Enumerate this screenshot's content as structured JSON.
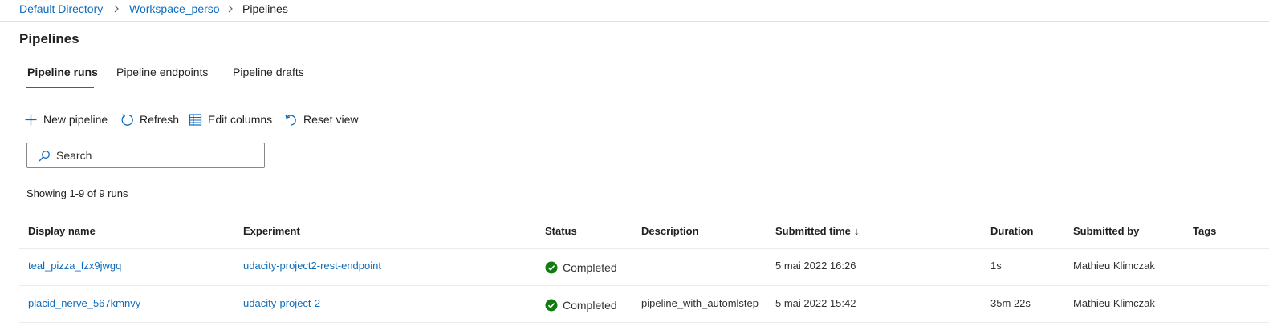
{
  "breadcrumb": {
    "items": [
      "Default Directory",
      "Workspace_perso",
      "Pipelines"
    ]
  },
  "page": {
    "title": "Pipelines"
  },
  "tabs": [
    {
      "label": "Pipeline runs",
      "active": true
    },
    {
      "label": "Pipeline endpoints",
      "active": false
    },
    {
      "label": "Pipeline drafts",
      "active": false
    }
  ],
  "toolbar": {
    "new_pipeline": "New pipeline",
    "refresh": "Refresh",
    "edit_columns": "Edit columns",
    "reset_view": "Reset view"
  },
  "search": {
    "placeholder": "Search",
    "value": ""
  },
  "summary": "Showing 1-9 of 9 runs",
  "table": {
    "columns": [
      "Display name",
      "Experiment",
      "Status",
      "Description",
      "Submitted time",
      "Duration",
      "Submitted by",
      "Tags"
    ],
    "sort_indicator": "↓",
    "rows": [
      {
        "display_name": "teal_pizza_fzx9jwgq",
        "experiment": "udacity-project2-rest-endpoint",
        "status": "Completed",
        "description": "",
        "submitted_time": "5 mai 2022 16:26",
        "duration": "1s",
        "submitted_by": "Mathieu Klimczak",
        "tags": ""
      },
      {
        "display_name": "placid_nerve_567kmnvy",
        "experiment": "udacity-project-2",
        "status": "Completed",
        "description": "pipeline_with_automlstep",
        "submitted_time": "5 mai 2022 15:42",
        "duration": "35m 22s",
        "submitted_by": "Mathieu Klimczak",
        "tags": ""
      }
    ]
  },
  "colors": {
    "link": "#0f6cbd",
    "success": "#107c10",
    "text": "#201f1e",
    "divider": "#edebe9"
  },
  "icons": {
    "breadcrumb_separator": "chevron-right-icon",
    "new_pipeline": "add-icon",
    "refresh": "refresh-icon",
    "edit_columns": "table-icon",
    "reset_view": "reset-icon",
    "search": "search-icon",
    "status_completed": "check-circle-icon"
  }
}
